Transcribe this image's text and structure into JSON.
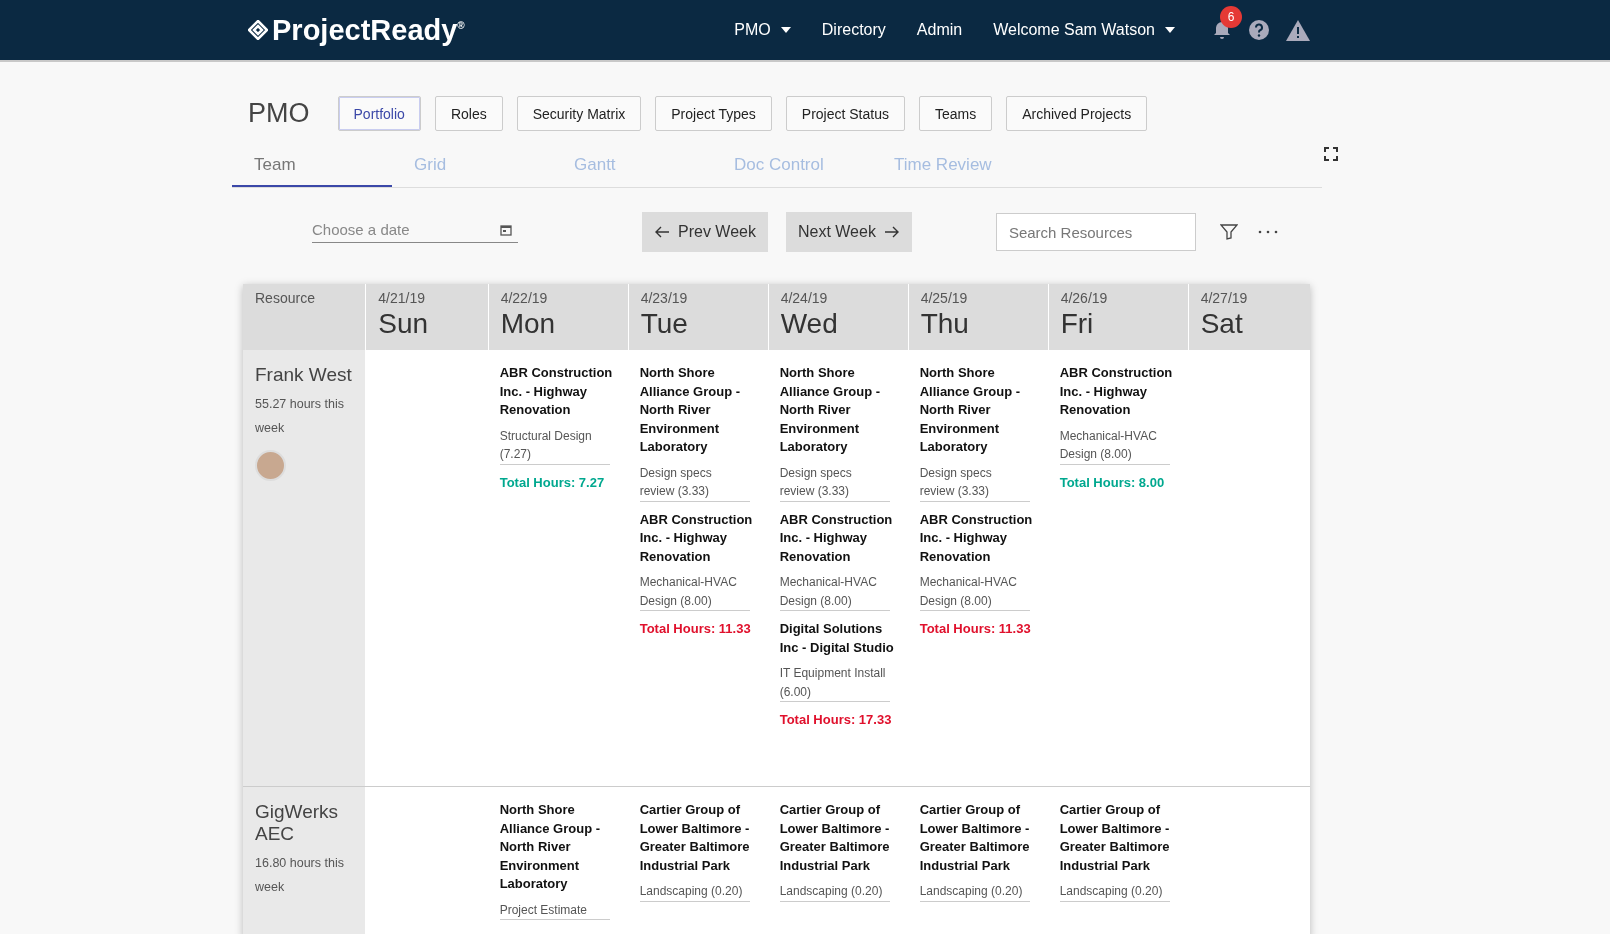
{
  "header": {
    "logo": "ProjectReady",
    "logo_mark": "®",
    "nav": [
      {
        "label": "PMO",
        "dropdown": true
      },
      {
        "label": "Directory",
        "dropdown": false
      },
      {
        "label": "Admin",
        "dropdown": false
      },
      {
        "label": "Welcome Sam Watson",
        "dropdown": true
      }
    ],
    "notifications": "6"
  },
  "page": {
    "title": "PMO",
    "buttons": [
      {
        "label": "Portfolio",
        "selected": true
      },
      {
        "label": "Roles",
        "selected": false
      },
      {
        "label": "Security Matrix",
        "selected": false
      },
      {
        "label": "Project Types",
        "selected": false
      },
      {
        "label": "Project Status",
        "selected": false
      },
      {
        "label": "Teams",
        "selected": false
      },
      {
        "label": "Archived Projects",
        "selected": false
      }
    ]
  },
  "tabs": [
    {
      "label": "Team",
      "selected": true
    },
    {
      "label": "Grid",
      "selected": false
    },
    {
      "label": "Gantt",
      "selected": false
    },
    {
      "label": "Doc Control",
      "selected": false
    },
    {
      "label": "Time Review",
      "selected": false
    }
  ],
  "toolbar": {
    "date_placeholder": "Choose a date",
    "prev": "Prev Week",
    "next": "Next Week",
    "search_placeholder": "Search Resources"
  },
  "table": {
    "resource_heading": "Resource",
    "days": [
      {
        "date": "4/21/19",
        "day": "Sun"
      },
      {
        "date": "4/22/19",
        "day": "Mon"
      },
      {
        "date": "4/23/19",
        "day": "Tue"
      },
      {
        "date": "4/24/19",
        "day": "Wed"
      },
      {
        "date": "4/25/19",
        "day": "Thu"
      },
      {
        "date": "4/26/19",
        "day": "Fri"
      },
      {
        "date": "4/27/19",
        "day": "Sat"
      }
    ],
    "rows": [
      {
        "name": "Frank West",
        "hours": "55.27 hours this week",
        "avatar": true,
        "cells": [
          {},
          {
            "entries": [
              {
                "project": "ABR Construction Inc. - Highway Renovation",
                "task": "Structural Design (7.27)"
              }
            ],
            "total": "Total Hours: 7.27",
            "color": "#00a88f"
          },
          {
            "entries": [
              {
                "project": "North Shore Alliance Group - North River Environment Laboratory",
                "task": "Design specs review (3.33)"
              },
              {
                "project": "ABR Construction Inc. - Highway Renovation",
                "task": "Mechanical-HVAC Design (8.00)"
              }
            ],
            "total": "Total Hours: 11.33",
            "color": "#e0102c"
          },
          {
            "entries": [
              {
                "project": "North Shore Alliance Group - North River Environment Laboratory",
                "task": "Design specs review (3.33)"
              },
              {
                "project": "ABR Construction Inc. - Highway Renovation",
                "task": "Mechanical-HVAC Design (8.00)"
              },
              {
                "project": "Digital Solutions Inc - Digital Studio",
                "task": "IT Equipment Install (6.00)"
              }
            ],
            "total": "Total Hours: 17.33",
            "color": "#e0102c"
          },
          {
            "entries": [
              {
                "project": "North Shore Alliance Group - North River Environment Laboratory",
                "task": "Design specs review (3.33)"
              },
              {
                "project": "ABR Construction Inc. - Highway Renovation",
                "task": "Mechanical-HVAC Design (8.00)"
              }
            ],
            "total": "Total Hours: 11.33",
            "color": "#e0102c"
          },
          {
            "entries": [
              {
                "project": "ABR Construction Inc. - Highway Renovation",
                "task": "Mechanical-HVAC Design (8.00)"
              }
            ],
            "total": "Total Hours: 8.00",
            "color": "#00a88f"
          },
          {}
        ]
      },
      {
        "name": "GigWerks AEC",
        "hours": "16.80 hours this week",
        "avatar": false,
        "cells": [
          {},
          {
            "entries": [
              {
                "project": "North Shore Alliance Group - North River Environment Laboratory",
                "task": "Project Estimate"
              }
            ]
          },
          {
            "entries": [
              {
                "project": "Cartier Group of Lower Baltimore - Greater Baltimore Industrial Park",
                "task": "Landscaping (0.20)"
              }
            ]
          },
          {
            "entries": [
              {
                "project": "Cartier Group of Lower Baltimore - Greater Baltimore Industrial Park",
                "task": "Landscaping (0.20)"
              }
            ]
          },
          {
            "entries": [
              {
                "project": "Cartier Group of Lower Baltimore - Greater Baltimore Industrial Park",
                "task": "Landscaping (0.20)"
              }
            ]
          },
          {
            "entries": [
              {
                "project": "Cartier Group of Lower Baltimore - Greater Baltimore Industrial Park",
                "task": "Landscaping (0.20)"
              }
            ]
          },
          {}
        ]
      }
    ]
  }
}
